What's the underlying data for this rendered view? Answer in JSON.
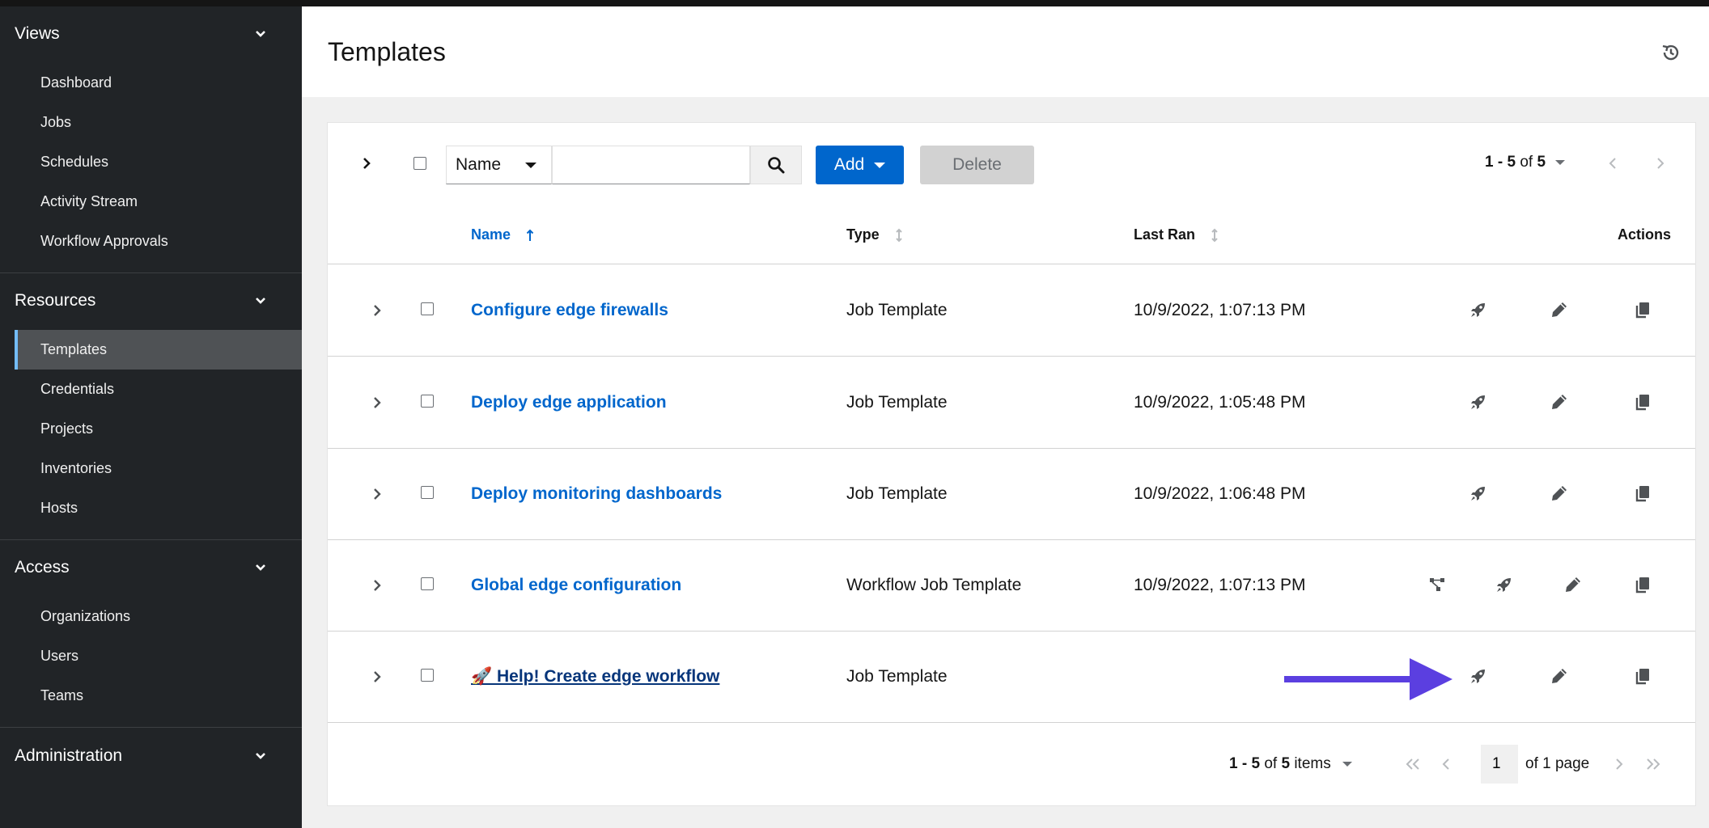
{
  "sidebar": {
    "groups": [
      {
        "label": "Views",
        "items": [
          "Dashboard",
          "Jobs",
          "Schedules",
          "Activity Stream",
          "Workflow Approvals"
        ]
      },
      {
        "label": "Resources",
        "items": [
          "Templates",
          "Credentials",
          "Projects",
          "Inventories",
          "Hosts"
        ]
      },
      {
        "label": "Access",
        "items": [
          "Organizations",
          "Users",
          "Teams"
        ]
      },
      {
        "label": "Administration",
        "items": []
      }
    ],
    "active_item": "Templates"
  },
  "header": {
    "title": "Templates"
  },
  "toolbar": {
    "filter_select": "Name",
    "search_value": "",
    "add_label": "Add",
    "delete_label": "Delete",
    "pagination": {
      "start": "1 - 5",
      "of": "of",
      "total": "5"
    }
  },
  "table": {
    "columns": {
      "name": "Name",
      "type": "Type",
      "last_ran": "Last Ran",
      "actions": "Actions"
    },
    "rows": [
      {
        "name": "Configure edge firewalls",
        "type": "Job Template",
        "last_ran": "10/9/2022, 1:07:13 PM"
      },
      {
        "name": "Deploy edge application",
        "type": "Job Template",
        "last_ran": "10/9/2022, 1:05:48 PM"
      },
      {
        "name": "Deploy monitoring dashboards",
        "type": "Job Template",
        "last_ran": "10/9/2022, 1:06:48 PM"
      },
      {
        "name": "Global edge configuration",
        "type": "Workflow Job Template",
        "last_ran": "10/9/2022, 1:07:13 PM"
      },
      {
        "name": "🚀 Help! Create edge workflow",
        "type": "Job Template",
        "last_ran": ""
      }
    ]
  },
  "footer": {
    "count_range": "1 - 5",
    "count_of": "of",
    "count_total": "5",
    "count_suffix": "items",
    "page_value": "1",
    "of_page": "of 1 page"
  },
  "colors": {
    "accent": "#0066cc",
    "sidebar_bg": "#212427",
    "annotation_arrow": "#5b3fe0"
  }
}
